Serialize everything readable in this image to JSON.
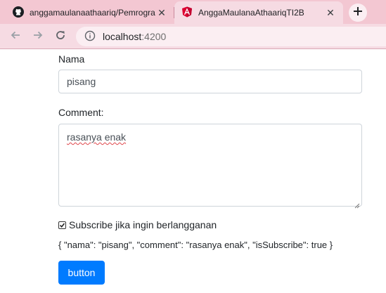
{
  "browser": {
    "tabs": [
      {
        "title": "anggamaulanaathaariq/Pemrogra",
        "icon": "github-icon",
        "active": false
      },
      {
        "title": "AnggaMaulanaAthaariqTI2B",
        "icon": "angular-icon",
        "active": true
      }
    ],
    "url_host": "localhost",
    "url_port": ":4200"
  },
  "form": {
    "nama_label": "Nama",
    "nama_value": "pisang",
    "comment_label": "Comment:",
    "comment_value": "rasanya enak",
    "subscribe_label": "Subscribe jika ingin berlangganan",
    "subscribe_checked": true,
    "json_output": "{ \"nama\": \"pisang\", \"comment\": \"rasanya enak\", \"isSubscribe\": true }",
    "button_label": "button",
    "button_color": "#007bff"
  }
}
